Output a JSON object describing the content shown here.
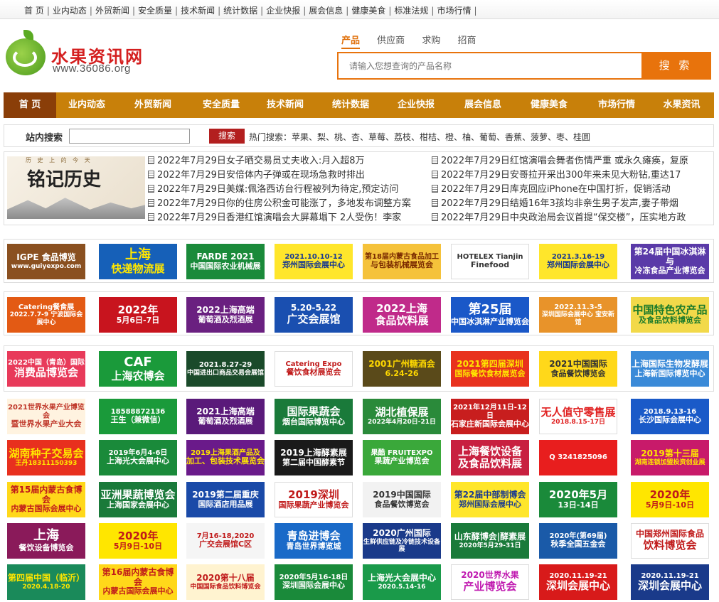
{
  "topbar": {
    "links": [
      "首 页",
      "业内动态",
      "外贸新闻",
      "安全质量",
      "技术新闻",
      "统计数据",
      "企业快报",
      "展会信息",
      "健康美食",
      "标准法规",
      "市场行情"
    ]
  },
  "logo": {
    "name": "水果资讯网",
    "url": "www.36086.org"
  },
  "search": {
    "tabs": [
      "产品",
      "供应商",
      "求购",
      "招商"
    ],
    "placeholder": "请输入您想查询的产品名称",
    "button": "搜 索"
  },
  "nav": [
    "首 页",
    "业内动态",
    "外贸新闻",
    "安全质量",
    "技术新闻",
    "统计数据",
    "企业快报",
    "展会信息",
    "健康美食",
    "市场行情",
    "水果资讯"
  ],
  "site_search": {
    "label": "站内搜索",
    "button": "搜索",
    "hot": "热门搜索：苹果、梨、桃、杏、草莓、荔枝、柑桔、橙、柚、葡萄、香蕉、菠萝、枣、桂圆"
  },
  "feature": {
    "title": "铭记历史",
    "subtitle": "历 史 上 的 今 天"
  },
  "news_left": [
    "2022年7月29日女子晒交易员丈夫收入:月入超8万",
    "2022年7月29日安倍体内子弹或在现场急救时排出",
    "2022年7月29日美媒:佩洛西访台行程被列为待定,预定访问",
    "2022年7月29日你的住房公积金可能涨了，多地发布调整方案",
    "2022年7月29日香港红馆演唱会大屏幕塌下 2人受伤！李家"
  ],
  "news_right": [
    "2022年7月29日红馆演唱会舞者伤情严重 或永久瘫痪，复原",
    "2022年7月29日安哥拉开采出300年来未见大粉钻,重达17",
    "2022年7月29日库克回应iPhone在中国打折，促销活动",
    "2022年7月29日结婚16年3孩均非亲生男子发声,妻子带烟",
    "2022年7月29日中央政治局会议首提“保交楼”，压实地方政"
  ],
  "ads": [
    [
      {
        "a": "IGPE 食品博览",
        "b": "www.guiyexpo.com",
        "bg": "#8a5020",
        "c": "#fff"
      },
      {
        "a": "上海",
        "b": "快递物流展",
        "bg": "#1660b8",
        "c": "#ffe600"
      },
      {
        "a": "FARDE 2021",
        "b": "中国国际农业机械展",
        "bg": "#1a8a3a",
        "c": "#fff"
      },
      {
        "a": "2021.10.10-12",
        "b": "郑州国际会展中心",
        "bg": "#ffe62b",
        "c": "#1a3a90"
      },
      {
        "a": "第18届内蒙古食品加工",
        "b": "与包装机械展览会",
        "bg": "#f5c23a",
        "c": "#7a2a00"
      },
      {
        "a": "HOTELEX Tianjin",
        "b": "Finefood",
        "bg": "#ffffff",
        "c": "#333"
      },
      {
        "a": "2021.3.16-19",
        "b": "郑州国际会展中心",
        "bg": "#ffe62b",
        "c": "#1a3a90"
      },
      {
        "a": "第24届中国冰淇淋与",
        "b": "冷冻食品产业博览会",
        "bg": "#5a3aa8",
        "c": "#fff"
      }
    ],
    [
      {
        "a": "Catering餐食展",
        "b": "2022.7.7-9 宁波国际会展中心",
        "bg": "#e35a14",
        "c": "#fff"
      },
      {
        "a": "2022年",
        "b": "5月6日-7日",
        "bg": "#c8141e",
        "c": "#fff"
      },
      {
        "a": "2022上海高端",
        "b": "葡萄酒及烈酒展",
        "bg": "#6a2080",
        "c": "#fff"
      },
      {
        "a": "5.20-5.22",
        "b": "广交会展馆",
        "bg": "#1a4fb0",
        "c": "#fff"
      },
      {
        "a": "2022上海",
        "b": "食品饮料展",
        "bg": "#c02a8a",
        "c": "#fff"
      },
      {
        "a": "第25届",
        "b": "中国冰淇淋产业博览会",
        "bg": "#1a58c8",
        "c": "#fff"
      },
      {
        "a": "2022.11.3-5",
        "b": "深圳国际会展中心 宝安新馆",
        "bg": "#e8932a",
        "c": "#fff"
      },
      {
        "a": "中国特色农产品",
        "b": "及食品饮料博览会",
        "bg": "#f2d94a",
        "c": "#1a7a2a"
      }
    ],
    [
      {
        "a": "2022中国（青岛）国际",
        "b": "消费品博览会",
        "bg": "#e83a5a",
        "c": "#fff"
      },
      {
        "a": "CAF",
        "b": "上海农博会",
        "bg": "#1a9a3a",
        "c": "#fff"
      },
      {
        "a": "2021.8.27-29",
        "b": "中国进出口商品交易会展馆",
        "bg": "#1a4a2a",
        "c": "#fff"
      },
      {
        "a": "Catering Expo",
        "b": "餐饮食材展览会",
        "bg": "#ffffff",
        "c": "#c01a1a"
      },
      {
        "a": "2001广州糖酒会",
        "b": "6.24-26",
        "bg": "#5a4a1a",
        "c": "#ffd800"
      },
      {
        "a": "2021第四届深圳",
        "b": "国际餐饮食材展览会",
        "bg": "#e8321e",
        "c": "#ffe600"
      },
      {
        "a": "2021中国国际",
        "b": "食品餐饮博览会",
        "bg": "#ffd81a",
        "c": "#333"
      },
      {
        "a": "上海国际生物发酵展",
        "b": "上海新国际博览中心",
        "bg": "#3a8ad8",
        "c": "#fff"
      }
    ],
    [
      {
        "a": "2021世界水果产业博览会",
        "b": "暨世界水果产业大会",
        "bg": "#fff3e0",
        "c": "#c0392b"
      },
      {
        "a": "18588872136",
        "b": "王生（兼微信）",
        "bg": "#1a9a3a",
        "c": "#fff"
      },
      {
        "a": "2021上海高端",
        "b": "葡萄酒及烈酒展",
        "bg": "#5a1a7a",
        "c": "#fff"
      },
      {
        "a": "国际果蔬会",
        "b": "烟台国际博览中心",
        "bg": "#1a7a3a",
        "c": "#fff"
      },
      {
        "a": "湖北植保展",
        "b": "2022年4月20日-21日",
        "bg": "#2a8a3a",
        "c": "#fff"
      },
      {
        "a": "2021年12月11日-12日",
        "b": "石家庄新国际会展中心",
        "bg": "#c81e1e",
        "c": "#fff"
      },
      {
        "a": "无人值守零售展",
        "b": "2018.8.15-17日",
        "bg": "#ffffff",
        "c": "#e02020"
      },
      {
        "a": "2018.9.13-16",
        "b": "长沙国际会展中心",
        "bg": "#1a5ac8",
        "c": "#fff"
      }
    ],
    [
      {
        "a": "湖南种子交易会",
        "b": "王丹18311150393",
        "bg": "#e8301e",
        "c": "#ffe600"
      },
      {
        "a": "2019年6月4-6日",
        "b": "上海光大会展中心",
        "bg": "#1a8a3a",
        "c": "#fff"
      },
      {
        "a": "2019上海果酒产品及",
        "b": "加工、包装技术展览会",
        "bg": "#6a1a8a",
        "c": "#ffe600"
      },
      {
        "a": "2019上海酵素展",
        "b": "第二届中国酵素节",
        "bg": "#1a1a1a",
        "c": "#fff"
      },
      {
        "a": "果酷 FRUITEXPO",
        "b": "果蔬产业博览会",
        "bg": "#3aa83a",
        "c": "#fff"
      },
      {
        "a": "上海餐饮设备",
        "b": "及食品饮料展",
        "bg": "#c82040",
        "c": "#fff"
      },
      {
        "a": "Q 3241825096",
        "b": "",
        "bg": "#e81e1e",
        "c": "#fff"
      },
      {
        "a": "2019第十三届",
        "b": "湖南连锁加盟投资创业展",
        "bg": "#c81a6a",
        "c": "#ffe600"
      }
    ],
    [
      {
        "a": "第15届内蒙古食博会",
        "b": "内蒙古国际会展中心",
        "bg": "#ffd81a",
        "c": "#c01a1a"
      },
      {
        "a": "亚洲果蔬博览会",
        "b": "上海国家会展中心",
        "bg": "#1a7a3a",
        "c": "#fff"
      },
      {
        "a": "2019第二届重庆",
        "b": "国际酒店用品展",
        "bg": "#1a4aa8",
        "c": "#fff"
      },
      {
        "a": "2019深圳",
        "b": "国际果蔬产业博览会",
        "bg": "#ffffff",
        "c": "#c01a1a"
      },
      {
        "a": "2019中国国际",
        "b": "食品餐饮博览会",
        "bg": "#f2f2f2",
        "c": "#333"
      },
      {
        "a": "第22届中部制博会",
        "b": "郑州国际会展中心",
        "bg": "#ffe62b",
        "c": "#1a3a90"
      },
      {
        "a": "2020年5月",
        "b": "13日-14日",
        "bg": "#1a8a3a",
        "c": "#fff"
      },
      {
        "a": "2020年",
        "b": "5月9日-10日",
        "bg": "#ffe600",
        "c": "#c01a1a"
      }
    ],
    [
      {
        "a": "上海",
        "b": "餐饮设备博览会",
        "bg": "#8a1a5a",
        "c": "#fff"
      },
      {
        "a": "2020年",
        "b": "5月9日-10日",
        "bg": "#ffe600",
        "c": "#c01a1a"
      },
      {
        "a": "7月16-18,2020",
        "b": "广交会展馆C区",
        "bg": "#f5f5f5",
        "c": "#c01a1a"
      },
      {
        "a": "青岛进博会",
        "b": "青岛世界博览城",
        "bg": "#1a6ac8",
        "c": "#fff"
      },
      {
        "a": "2020广州国际",
        "b": "生鲜供应链及冷链技术设备展",
        "bg": "#1a3a8a",
        "c": "#fff"
      },
      {
        "a": "山东酵博会|酵素展",
        "b": "2020年5月29-31日",
        "bg": "#1a7a3a",
        "c": "#fff"
      },
      {
        "a": "2020年(第69届)",
        "b": "秋季全国五金会",
        "bg": "#1a5aa8",
        "c": "#fff"
      },
      {
        "a": "中国郑州国际食品",
        "b": "饮料博览会",
        "bg": "#ffffff",
        "c": "#c01a1a"
      }
    ],
    [
      {
        "a": "第四届中国（临沂）",
        "b": "2020.4.18-20",
        "bg": "#1a8a5a",
        "c": "#ffe600"
      },
      {
        "a": "第16届内蒙古食博会",
        "b": "内蒙古国际会展中心",
        "bg": "#ffd81a",
        "c": "#c01a1a"
      },
      {
        "a": "2020第十八届",
        "b": "中国国际食品饮料博览会",
        "bg": "#fff3d0",
        "c": "#c01a1a"
      },
      {
        "a": "2020年5月16-18日",
        "b": "深圳国际会展中心",
        "bg": "#1a8a3a",
        "c": "#fff"
      },
      {
        "a": "上海光大会展中心",
        "b": "2020.5.14-16",
        "bg": "#1a9a4a",
        "c": "#fff"
      },
      {
        "a": "2020世界水果",
        "b": "产业博览会",
        "bg": "#ffffff",
        "c": "#c01ab0"
      },
      {
        "a": "2020.11.19-21",
        "b": "深圳会展中心",
        "bg": "#d81a1a",
        "c": "#fff"
      },
      {
        "a": "2020.11.19-21",
        "b": "深圳会展中心",
        "bg": "#1a3a8a",
        "c": "#fff"
      }
    ]
  ]
}
